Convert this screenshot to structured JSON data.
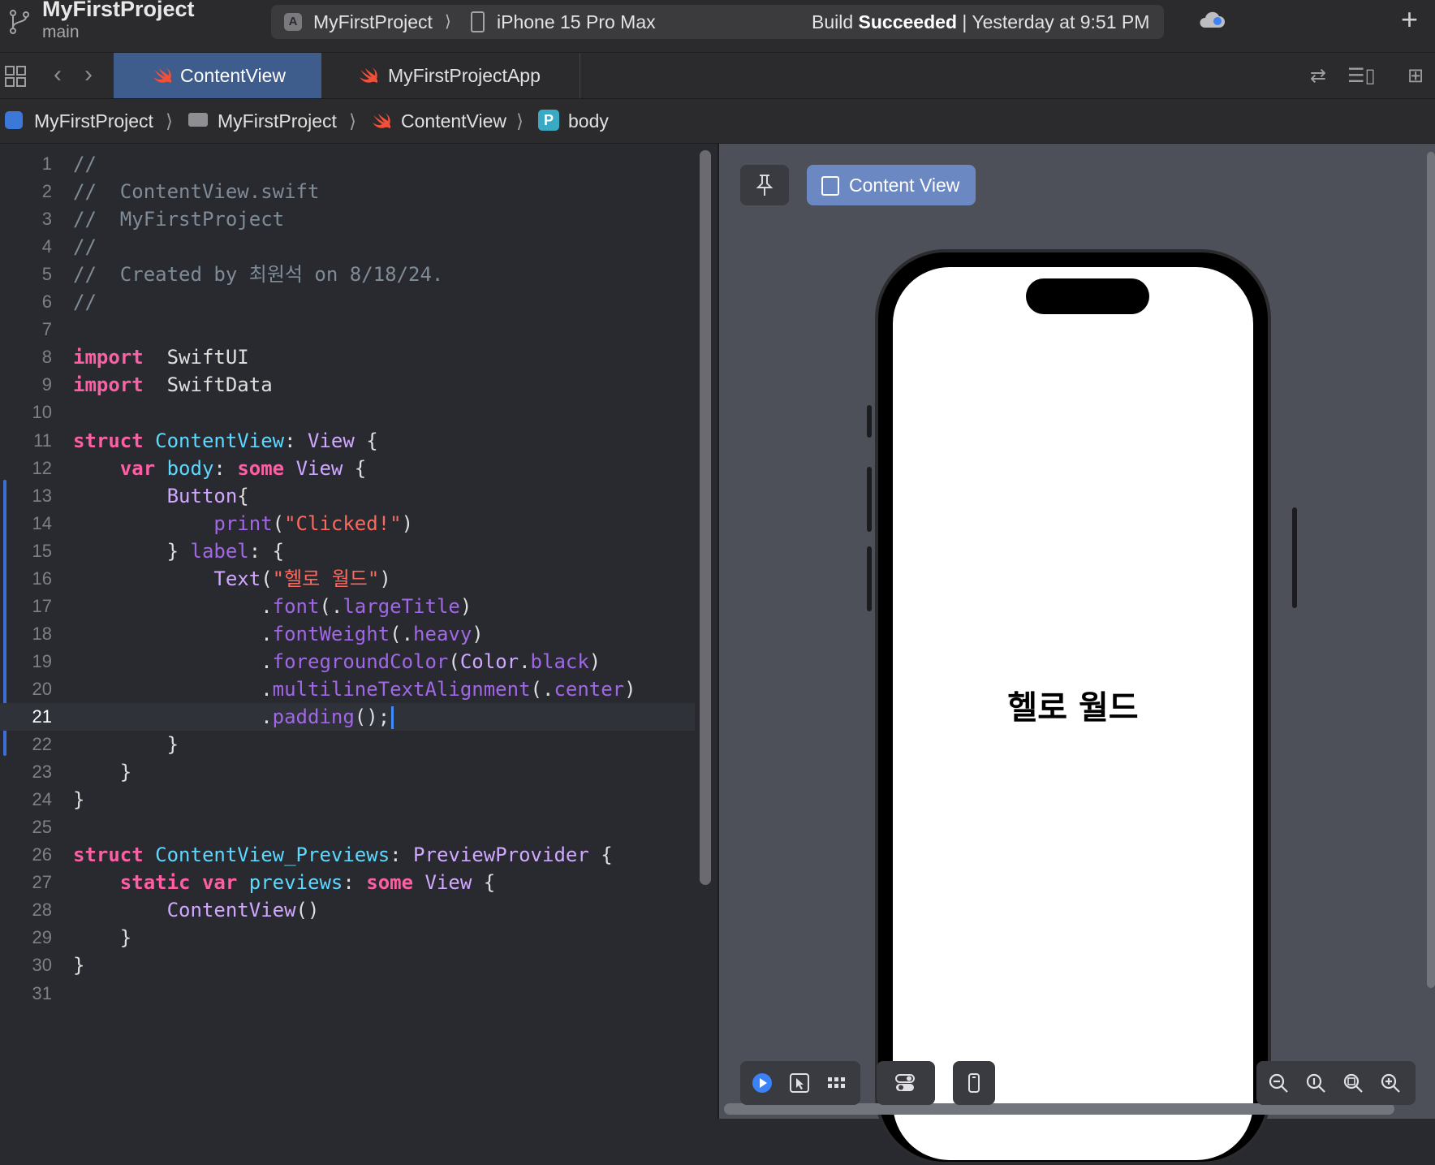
{
  "toolbar": {
    "project_name": "MyFirstProject",
    "branch": "main",
    "scheme": "MyFirstProject",
    "device": "iPhone 15 Pro Max",
    "build_prefix": "Build ",
    "build_result": "Succeeded",
    "build_time": " | Yesterday at 9:51 PM"
  },
  "tabs": [
    {
      "label": "ContentView",
      "active": true
    },
    {
      "label": "MyFirstProjectApp",
      "active": false
    }
  ],
  "breadcrumb": {
    "items": [
      "MyFirstProject",
      "MyFirstProject",
      "ContentView",
      "body"
    ],
    "separator": "⟩",
    "symbol_badge": "P"
  },
  "editor": {
    "current_line": 21,
    "line_numbers": [
      "1",
      "2",
      "3",
      "4",
      "5",
      "6",
      "7",
      "8",
      "9",
      "10",
      "11",
      "12",
      "13",
      "14",
      "15",
      "16",
      "17",
      "18",
      "19",
      "20",
      "21",
      "22",
      "23",
      "24",
      "25",
      "26",
      "27",
      "28",
      "29",
      "30",
      "31"
    ],
    "lines": [
      [
        [
          "cmt",
          "//"
        ]
      ],
      [
        [
          "cmt",
          "//  ContentView.swift"
        ]
      ],
      [
        [
          "cmt",
          "//  MyFirstProject"
        ]
      ],
      [
        [
          "cmt",
          "//"
        ]
      ],
      [
        [
          "cmt",
          "//  Created by 최원석 on 8/18/24."
        ]
      ],
      [
        [
          "cmt",
          "//"
        ]
      ],
      [],
      [
        [
          "kw",
          "import"
        ],
        [
          "",
          "  SwiftUI"
        ]
      ],
      [
        [
          "kw",
          "import"
        ],
        [
          "",
          "  SwiftData"
        ]
      ],
      [],
      [
        [
          "kw",
          "struct"
        ],
        [
          "",
          " "
        ],
        [
          "decl",
          "ContentView"
        ],
        [
          "",
          ": "
        ],
        [
          "ty",
          "View"
        ],
        [
          "",
          " {"
        ]
      ],
      [
        [
          "",
          "    "
        ],
        [
          "kw",
          "var"
        ],
        [
          "",
          " "
        ],
        [
          "decl",
          "body"
        ],
        [
          "",
          ": "
        ],
        [
          "kw",
          "some"
        ],
        [
          "",
          " "
        ],
        [
          "ty",
          "View"
        ],
        [
          "",
          " {"
        ]
      ],
      [
        [
          "",
          "        "
        ],
        [
          "fn2",
          "Button"
        ],
        [
          "",
          "{"
        ]
      ],
      [
        [
          "",
          "            "
        ],
        [
          "fn",
          "print"
        ],
        [
          "",
          "("
        ],
        [
          "str",
          "\"Clicked!\""
        ],
        [
          "",
          ")"
        ]
      ],
      [
        [
          "",
          "        } "
        ],
        [
          "fn",
          "label"
        ],
        [
          "",
          ": {"
        ]
      ],
      [
        [
          "",
          "            "
        ],
        [
          "fn2",
          "Text"
        ],
        [
          "",
          "("
        ],
        [
          "str",
          "\"헬로 월드\""
        ],
        [
          "",
          ")"
        ]
      ],
      [
        [
          "",
          "                ."
        ],
        [
          "pr",
          "font"
        ],
        [
          "",
          "(."
        ],
        [
          "pr",
          "largeTitle"
        ],
        [
          "",
          ")"
        ]
      ],
      [
        [
          "",
          "                ."
        ],
        [
          "pr",
          "fontWeight"
        ],
        [
          "",
          "(."
        ],
        [
          "pr",
          "heavy"
        ],
        [
          "",
          ")"
        ]
      ],
      [
        [
          "",
          "                ."
        ],
        [
          "pr",
          "foregroundColor"
        ],
        [
          "",
          "("
        ],
        [
          "fn2",
          "Color"
        ],
        [
          "",
          "."
        ],
        [
          "pr",
          "black"
        ],
        [
          "",
          ")"
        ]
      ],
      [
        [
          "",
          "                ."
        ],
        [
          "pr",
          "multilineTextAlignment"
        ],
        [
          "",
          "(."
        ],
        [
          "pr",
          "center"
        ],
        [
          "",
          ")"
        ]
      ],
      [
        [
          "",
          "                ."
        ],
        [
          "pr",
          "padding"
        ],
        [
          "",
          "();"
        ]
      ],
      [
        [
          "",
          "        }"
        ]
      ],
      [
        [
          "",
          "    }"
        ]
      ],
      [
        [
          "",
          "}"
        ]
      ],
      [],
      [
        [
          "kw",
          "struct"
        ],
        [
          "",
          " "
        ],
        [
          "decl",
          "ContentView_Previews"
        ],
        [
          "",
          ": "
        ],
        [
          "ty",
          "PreviewProvider"
        ],
        [
          "",
          " {"
        ]
      ],
      [
        [
          "",
          "    "
        ],
        [
          "kw",
          "static"
        ],
        [
          "",
          " "
        ],
        [
          "kw",
          "var"
        ],
        [
          "",
          " "
        ],
        [
          "decl",
          "previews"
        ],
        [
          "",
          ": "
        ],
        [
          "kw",
          "some"
        ],
        [
          "",
          " "
        ],
        [
          "ty",
          "View"
        ],
        [
          "",
          " {"
        ]
      ],
      [
        [
          "",
          "        "
        ],
        [
          "fn2",
          "ContentView"
        ],
        [
          "",
          "()"
        ]
      ],
      [
        [
          "",
          "    }"
        ]
      ],
      [
        [
          "",
          "}"
        ]
      ],
      []
    ]
  },
  "preview": {
    "selector_label": "Content View",
    "preview_text": "헬로 월드"
  },
  "icons": {
    "branch": "branch-icon",
    "cloud": "cloud-sync-icon",
    "add": "plus-icon",
    "pin": "pin-icon",
    "live": "play-icon",
    "select": "cursor-icon",
    "variants": "grid-icon",
    "settings": "toggle-settings-icon",
    "device": "device-icon",
    "zoom": [
      "zoom-out-icon",
      "zoom-actual-icon",
      "zoom-fit-icon",
      "zoom-in-icon"
    ]
  },
  "colors": {
    "accent": "#3e5c8c",
    "keyword": "#fc5fa3",
    "string": "#fc6a5d",
    "comment": "#7f8c98"
  }
}
